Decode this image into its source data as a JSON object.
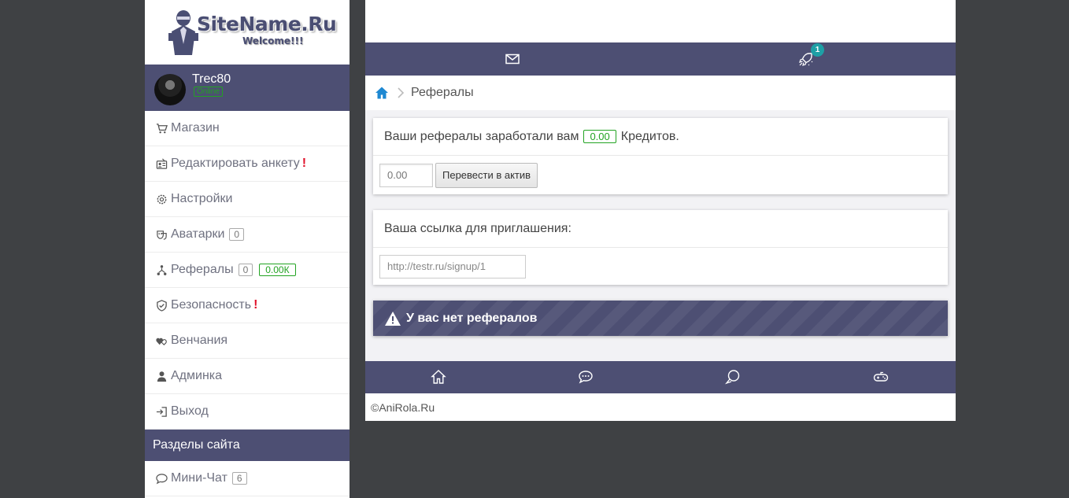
{
  "site": {
    "title": "SiteName.Ru",
    "subtitle": "Welcome!!!"
  },
  "user": {
    "name": "Trec80",
    "status": "Online"
  },
  "menu": {
    "items": [
      {
        "label": "Магазин",
        "icon": "cart-icon"
      },
      {
        "label": "Редактировать анкету",
        "icon": "profile-edit-icon",
        "alert": "!"
      },
      {
        "label": "Настройки",
        "icon": "gear-icon"
      },
      {
        "label": "Аватарки",
        "icon": "avatars-icon",
        "count": "0"
      },
      {
        "label": "Рефералы",
        "icon": "referrals-icon",
        "count": "0",
        "credits": "0.00К"
      },
      {
        "label": "Безопасность",
        "icon": "shield-icon",
        "alert": "!"
      },
      {
        "label": "Венчания",
        "icon": "hearts-icon"
      },
      {
        "label": "Админка",
        "icon": "admin-icon"
      },
      {
        "label": "Выход",
        "icon": "logout-icon"
      }
    ]
  },
  "sections": {
    "title": "Разделы сайта",
    "items": [
      {
        "label": "Мини-Чат",
        "icon": "chat-icon",
        "count": "6"
      }
    ]
  },
  "top_nav": {
    "icons": [
      "mail-icon",
      "rocket-icon"
    ],
    "notification_count": "1"
  },
  "breadcrumb": {
    "current": "Рефералы"
  },
  "earnings": {
    "text_before": "Ваши рефералы заработали вам",
    "amount": "0.00",
    "text_after": "Кредитов.",
    "input_placeholder": "0.00",
    "button_label": "Перевести в актив"
  },
  "invite": {
    "title": "Ваша ссылка для приглашения:",
    "link": "http://testr.ru/signup/1"
  },
  "alert": {
    "text": "У вас нет рефералов"
  },
  "bottom_nav": {
    "icons": [
      "home-icon",
      "chat-bubble-icon",
      "comments-icon",
      "gamepad-icon"
    ]
  },
  "footer": {
    "copyright": "©AniRola.Ru"
  },
  "colors": {
    "page_bg": "#3f4144",
    "accent": "#4d4f73",
    "success": "#22a322",
    "danger": "#e0112a",
    "notif": "#1ea0a6",
    "home_icon": "#1e88d2"
  }
}
